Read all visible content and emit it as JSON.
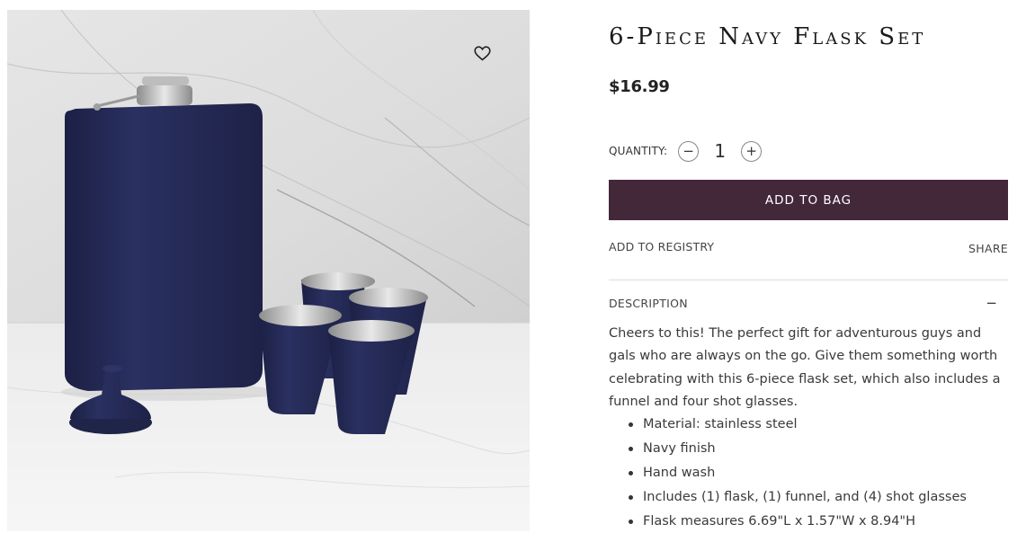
{
  "product": {
    "title": "6-Piece Navy Flask Set",
    "price": "$16.99",
    "image_alt": "Navy flask, funnel and four shot glasses on marble",
    "quantity_label": "QUANTITY:",
    "quantity": "1",
    "minus_symbol": "−",
    "plus_symbol": "+",
    "add_to_bag": "ADD TO BAG",
    "add_to_registry": "ADD TO REGISTRY",
    "share": "SHARE"
  },
  "description": {
    "heading": "DESCRIPTION",
    "collapse_symbol": "−",
    "text": "Cheers to this! The perfect gift for adventurous guys and gals who are always on the go. Give them something worth celebrating with this 6-piece flask set, which also includes a funnel and four shot glasses.",
    "features": [
      "Material: stainless steel",
      "Navy finish",
      "Hand wash",
      "Includes (1) flask, (1) funnel, and (4) shot glasses",
      "Flask measures 6.69\"L x 1.57\"W x 8.94\"H"
    ]
  },
  "icons": {
    "wishlist": "heart-icon"
  },
  "colors": {
    "accent": "#43283a",
    "flask": "#262c55"
  }
}
